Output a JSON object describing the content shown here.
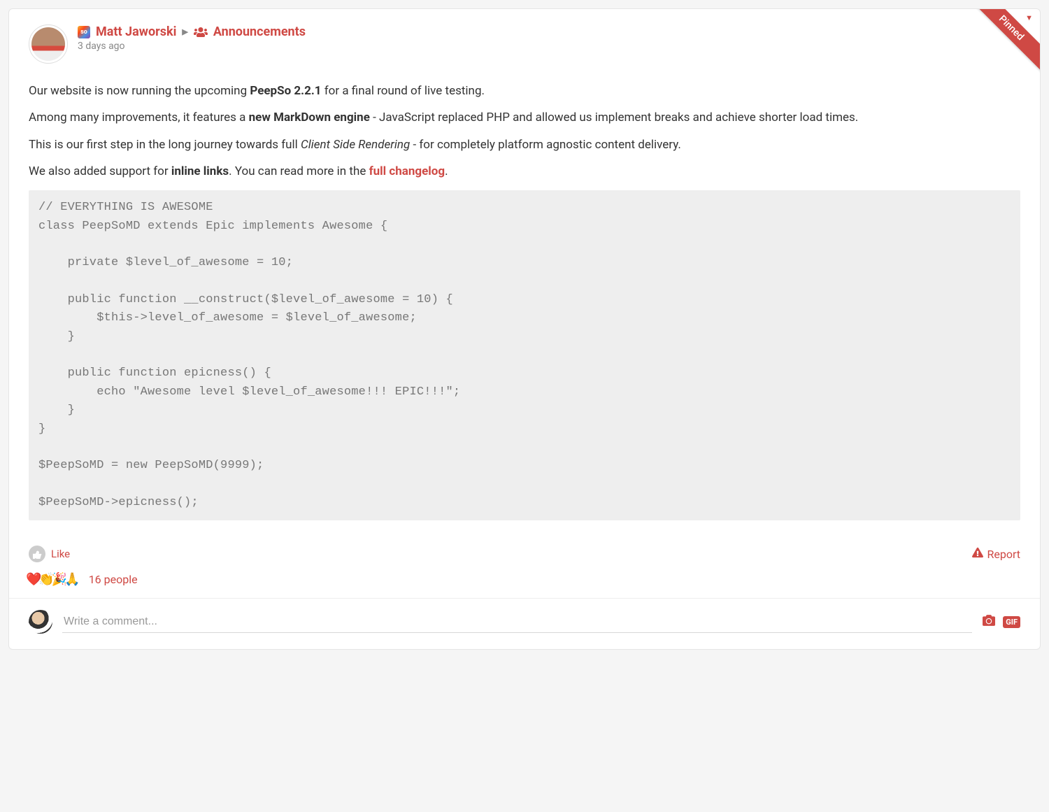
{
  "pinned_label": "Pinned",
  "header": {
    "badge_text": "so",
    "author": "Matt Jaworski",
    "group": "Announcements",
    "timestamp": "3 days ago"
  },
  "body": {
    "p1_pre": "Our website is now running the upcoming ",
    "p1_bold": "PeepSo 2.2.1",
    "p1_post": " for a final round of live testing.",
    "p2_pre": "Among many improvements, it features a ",
    "p2_bold": "new MarkDown engine",
    "p2_post": " - JavaScript replaced PHP and allowed us implement breaks and achieve shorter load times.",
    "p3_pre": "This is our first step in the long journey towards full ",
    "p3_em": "Client Side Rendering",
    "p3_post": " - for completely platform agnostic content delivery.",
    "p4_pre": "We also added support for ",
    "p4_bold": "inline links",
    "p4_mid": ". You can read more in the ",
    "p4_link": "full changelog",
    "p4_end": ".",
    "code": "// EVERYTHING IS AWESOME\nclass PeepSoMD extends Epic implements Awesome {\n\n    private $level_of_awesome = 10;\n\n    public function __construct($level_of_awesome = 10) {\n        $this->level_of_awesome = $level_of_awesome;\n    }\n\n    public function epicness() {\n        echo \"Awesome level $level_of_awesome!!! EPIC!!!\";\n    }\n}\n\n$PeepSoMD = new PeepSoMD(9999);\n\n$PeepSoMD->epicness();"
  },
  "actions": {
    "like": "Like",
    "report": "Report"
  },
  "reactions": {
    "emojis": [
      "❤️",
      "👏",
      "🎉",
      "🙏"
    ],
    "count_label": "16 people"
  },
  "comment": {
    "placeholder": "Write a comment...",
    "gif_label": "GIF"
  }
}
